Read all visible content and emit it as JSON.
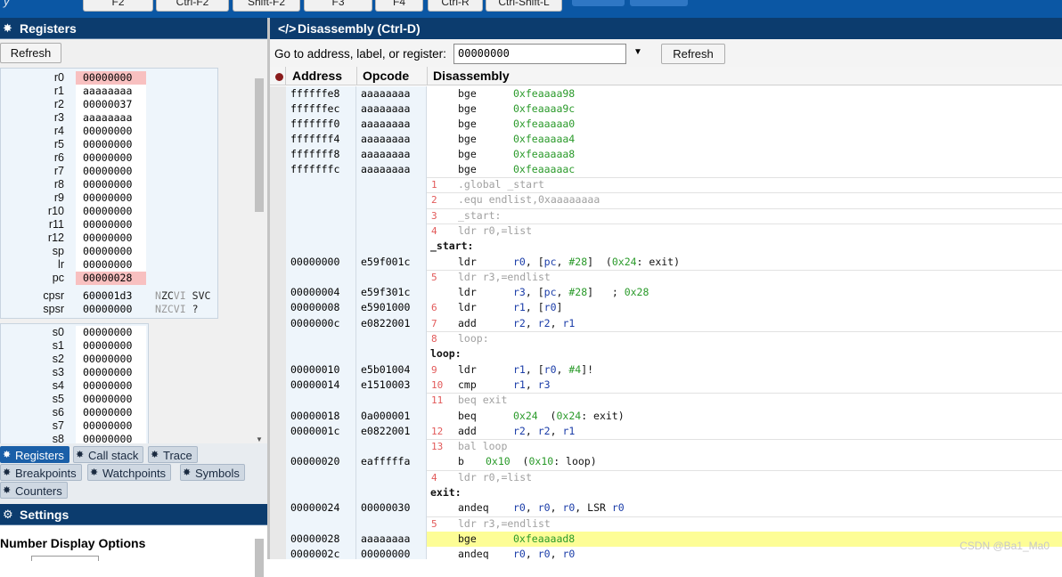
{
  "topbar": {
    "app_fragment": "y",
    "keys": [
      "F2",
      "Ctrl-F2",
      "Shift-F2",
      "F3",
      "F4",
      "Ctrl-R",
      "Ctrl-Shift-L"
    ]
  },
  "registers_panel": {
    "title": "Registers",
    "refresh_label": "Refresh",
    "core": [
      {
        "name": "r0",
        "value": "00000000",
        "highlight": true
      },
      {
        "name": "r1",
        "value": "aaaaaaaa"
      },
      {
        "name": "r2",
        "value": "00000037"
      },
      {
        "name": "r3",
        "value": "aaaaaaaa"
      },
      {
        "name": "r4",
        "value": "00000000"
      },
      {
        "name": "r5",
        "value": "00000000"
      },
      {
        "name": "r6",
        "value": "00000000"
      },
      {
        "name": "r7",
        "value": "00000000"
      },
      {
        "name": "r8",
        "value": "00000000"
      },
      {
        "name": "r9",
        "value": "00000000"
      },
      {
        "name": "r10",
        "value": "00000000"
      },
      {
        "name": "r11",
        "value": "00000000"
      },
      {
        "name": "r12",
        "value": "00000000"
      },
      {
        "name": "sp",
        "value": "00000000"
      },
      {
        "name": "lr",
        "value": "00000000"
      },
      {
        "name": "pc",
        "value": "00000028",
        "highlight": true
      }
    ],
    "status": [
      {
        "name": "cpsr",
        "value": "600001d3",
        "flags_dim_1": "N",
        "flags_on": "ZC",
        "flags_dim_2": "VI",
        "mode": "SVC"
      },
      {
        "name": "spsr",
        "value": "00000000",
        "flags_dim_1": "NZCVI",
        "flags_on": "",
        "flags_dim_2": "",
        "mode": "?"
      }
    ],
    "float": [
      {
        "name": "s0",
        "value": "00000000"
      },
      {
        "name": "s1",
        "value": "00000000"
      },
      {
        "name": "s2",
        "value": "00000000"
      },
      {
        "name": "s3",
        "value": "00000000"
      },
      {
        "name": "s4",
        "value": "00000000"
      },
      {
        "name": "s5",
        "value": "00000000"
      },
      {
        "name": "s6",
        "value": "00000000"
      },
      {
        "name": "s7",
        "value": "00000000"
      },
      {
        "name": "s8",
        "value": "00000000"
      }
    ]
  },
  "tabs": [
    {
      "label": "Registers",
      "active": true
    },
    {
      "label": "Call stack"
    },
    {
      "label": "Trace"
    },
    {
      "label": "Breakpoints"
    },
    {
      "label": "Watchpoints"
    },
    {
      "label": "Symbols"
    },
    {
      "label": "Counters"
    }
  ],
  "settings_panel": {
    "title": "Settings",
    "section": "Number Display Options"
  },
  "disassembly": {
    "title": "Disassembly (Ctrl-D)",
    "goto_label": "Go to address, label, or register:",
    "goto_value": "00000000",
    "refresh_label": "Refresh",
    "columns": [
      "Address",
      "Opcode",
      "Disassembly"
    ],
    "rows": [
      {
        "kind": "ins",
        "addr": "ffffffe8",
        "op": "aaaaaaaa",
        "mn": "bge",
        "args": [
          {
            "t": "0xfeaaaa98",
            "c": "g"
          }
        ]
      },
      {
        "kind": "ins",
        "addr": "ffffffec",
        "op": "aaaaaaaa",
        "mn": "bge",
        "args": [
          {
            "t": "0xfeaaaa9c",
            "c": "g"
          }
        ]
      },
      {
        "kind": "ins",
        "addr": "fffffff0",
        "op": "aaaaaaaa",
        "mn": "bge",
        "args": [
          {
            "t": "0xfeaaaaa0",
            "c": "g"
          }
        ]
      },
      {
        "kind": "ins",
        "addr": "fffffff4",
        "op": "aaaaaaaa",
        "mn": "bge",
        "args": [
          {
            "t": "0xfeaaaaa4",
            "c": "g"
          }
        ]
      },
      {
        "kind": "ins",
        "addr": "fffffff8",
        "op": "aaaaaaaa",
        "mn": "bge",
        "args": [
          {
            "t": "0xfeaaaaa8",
            "c": "g"
          }
        ]
      },
      {
        "kind": "ins",
        "addr": "fffffffc",
        "op": "aaaaaaaa",
        "mn": "bge",
        "args": [
          {
            "t": "0xfeaaaaac",
            "c": "g"
          }
        ]
      },
      {
        "kind": "src",
        "ln": "1",
        "text": ".global _start"
      },
      {
        "kind": "src",
        "ln": "2",
        "text": ".equ endlist,0xaaaaaaaa"
      },
      {
        "kind": "src",
        "ln": "3",
        "text": "_start:"
      },
      {
        "kind": "src",
        "ln": "4",
        "text": "ldr r0,=list"
      },
      {
        "kind": "label",
        "text": "_start:"
      },
      {
        "kind": "ins",
        "addr": "00000000",
        "op": "e59f001c",
        "mn": "ldr",
        "args": [
          {
            "t": "r0",
            "c": "b"
          },
          {
            "t": ", [",
            "c": "k"
          },
          {
            "t": "pc",
            "c": "b"
          },
          {
            "t": ", ",
            "c": "k"
          },
          {
            "t": "#28",
            "c": "g"
          },
          {
            "t": "]  (",
            "c": "k"
          },
          {
            "t": "0x24",
            "c": "g"
          },
          {
            "t": ": exit)",
            "c": "k"
          }
        ]
      },
      {
        "kind": "src",
        "ln": "5",
        "text": "ldr r3,=endlist"
      },
      {
        "kind": "ins",
        "addr": "00000004",
        "op": "e59f301c",
        "mn": "ldr",
        "args": [
          {
            "t": "r3",
            "c": "b"
          },
          {
            "t": ", [",
            "c": "k"
          },
          {
            "t": "pc",
            "c": "b"
          },
          {
            "t": ", ",
            "c": "k"
          },
          {
            "t": "#28",
            "c": "g"
          },
          {
            "t": "]   ; ",
            "c": "k"
          },
          {
            "t": "0x28",
            "c": "g"
          }
        ]
      },
      {
        "kind": "ins",
        "addr": "00000008",
        "op": "e5901000",
        "ln": "6",
        "mn": "ldr",
        "args": [
          {
            "t": "r1",
            "c": "b"
          },
          {
            "t": ", [",
            "c": "k"
          },
          {
            "t": "r0",
            "c": "b"
          },
          {
            "t": "]",
            "c": "k"
          }
        ]
      },
      {
        "kind": "ins",
        "addr": "0000000c",
        "op": "e0822001",
        "ln": "7",
        "mn": "add",
        "args": [
          {
            "t": "r2",
            "c": "b"
          },
          {
            "t": ", ",
            "c": "k"
          },
          {
            "t": "r2",
            "c": "b"
          },
          {
            "t": ", ",
            "c": "k"
          },
          {
            "t": "r1",
            "c": "b"
          }
        ]
      },
      {
        "kind": "src",
        "ln": "8",
        "text": "loop:"
      },
      {
        "kind": "label",
        "text": "loop:"
      },
      {
        "kind": "ins",
        "addr": "00000010",
        "op": "e5b01004",
        "ln": "9",
        "mn": "ldr",
        "args": [
          {
            "t": "r1",
            "c": "b"
          },
          {
            "t": ", [",
            "c": "k"
          },
          {
            "t": "r0",
            "c": "b"
          },
          {
            "t": ", ",
            "c": "k"
          },
          {
            "t": "#4",
            "c": "g"
          },
          {
            "t": "]!",
            "c": "k"
          }
        ]
      },
      {
        "kind": "ins",
        "addr": "00000014",
        "op": "e1510003",
        "ln": "10",
        "mn": "cmp",
        "args": [
          {
            "t": "r1",
            "c": "b"
          },
          {
            "t": ", ",
            "c": "k"
          },
          {
            "t": "r3",
            "c": "b"
          }
        ]
      },
      {
        "kind": "src",
        "ln": "11",
        "text": "beq exit"
      },
      {
        "kind": "ins",
        "addr": "00000018",
        "op": "0a000001",
        "mn": "beq",
        "args": [
          {
            "t": "0x24",
            "c": "g"
          },
          {
            "t": "  (",
            "c": "k"
          },
          {
            "t": "0x24",
            "c": "g"
          },
          {
            "t": ": exit)",
            "c": "k"
          }
        ]
      },
      {
        "kind": "ins",
        "addr": "0000001c",
        "op": "e0822001",
        "ln": "12",
        "mn": "add",
        "args": [
          {
            "t": "r2",
            "c": "b"
          },
          {
            "t": ", ",
            "c": "k"
          },
          {
            "t": "r2",
            "c": "b"
          },
          {
            "t": ", ",
            "c": "k"
          },
          {
            "t": "r1",
            "c": "b"
          }
        ]
      },
      {
        "kind": "src",
        "ln": "13",
        "text": "bal loop"
      },
      {
        "kind": "ins",
        "addr": "00000020",
        "op": "eafffffa",
        "mn": "b",
        "args": [
          {
            "t": "0x10",
            "c": "g"
          },
          {
            "t": "  (",
            "c": "k"
          },
          {
            "t": "0x10",
            "c": "g"
          },
          {
            "t": ": loop)",
            "c": "k"
          }
        ],
        "short": true
      },
      {
        "kind": "src",
        "ln": "4",
        "text": "ldr r0,=list"
      },
      {
        "kind": "label",
        "text": "exit:"
      },
      {
        "kind": "ins",
        "addr": "00000024",
        "op": "00000030",
        "mn": "andeq",
        "args": [
          {
            "t": "r0",
            "c": "b"
          },
          {
            "t": ", ",
            "c": "k"
          },
          {
            "t": "r0",
            "c": "b"
          },
          {
            "t": ", ",
            "c": "k"
          },
          {
            "t": "r0",
            "c": "b"
          },
          {
            "t": ", LSR ",
            "c": "k"
          },
          {
            "t": "r0",
            "c": "b"
          }
        ]
      },
      {
        "kind": "src",
        "ln": "5",
        "text": "ldr r3,=endlist"
      },
      {
        "kind": "ins",
        "addr": "00000028",
        "op": "aaaaaaaa",
        "mn": "bge",
        "args": [
          {
            "t": "0xfeaaaad8",
            "c": "g"
          }
        ],
        "current": true
      },
      {
        "kind": "ins",
        "addr": "0000002c",
        "op": "00000000",
        "mn": "andeq",
        "args": [
          {
            "t": "r0",
            "c": "b"
          },
          {
            "t": ", ",
            "c": "k"
          },
          {
            "t": "r0",
            "c": "b"
          },
          {
            "t": ", ",
            "c": "k"
          },
          {
            "t": "r0",
            "c": "b"
          }
        ]
      }
    ]
  },
  "watermark": "CSDN @Ba1_Ma0",
  "colors": {
    "header_bg": "#0c3c6e",
    "topbar_bg": "#0b57a4",
    "current_line": "#fdfd96",
    "reg_changed": "#f8c0c0"
  }
}
